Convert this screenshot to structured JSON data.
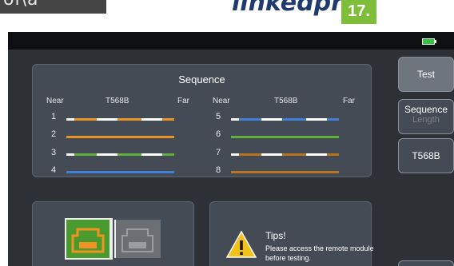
{
  "header": {
    "left_text": "ol\\a",
    "brand": "linkedpro",
    "badge": "17."
  },
  "screen": {
    "sequence": {
      "title": "Sequence",
      "near_label": "Near",
      "standard_label": "T568B",
      "far_label": "Far",
      "left_pins": [
        "1",
        "2",
        "3",
        "4"
      ],
      "right_pins": [
        "5",
        "6",
        "7",
        "8"
      ],
      "colors": {
        "orange": "#e8922a",
        "white": "#ffffff",
        "green": "#5fb03c",
        "blue": "#3f7fd6",
        "brown": "#b8741e"
      }
    },
    "side_buttons": {
      "test": "Test",
      "sequence": "Sequence",
      "length": "Length",
      "t568b": "T568B"
    },
    "tips": {
      "title": "Tips!",
      "message": "Please access the remote module before testing."
    },
    "ports": {
      "active_color": "#4a9b2e",
      "active_icon_color": "#f29222",
      "inactive_color": "#6b6f74"
    }
  }
}
